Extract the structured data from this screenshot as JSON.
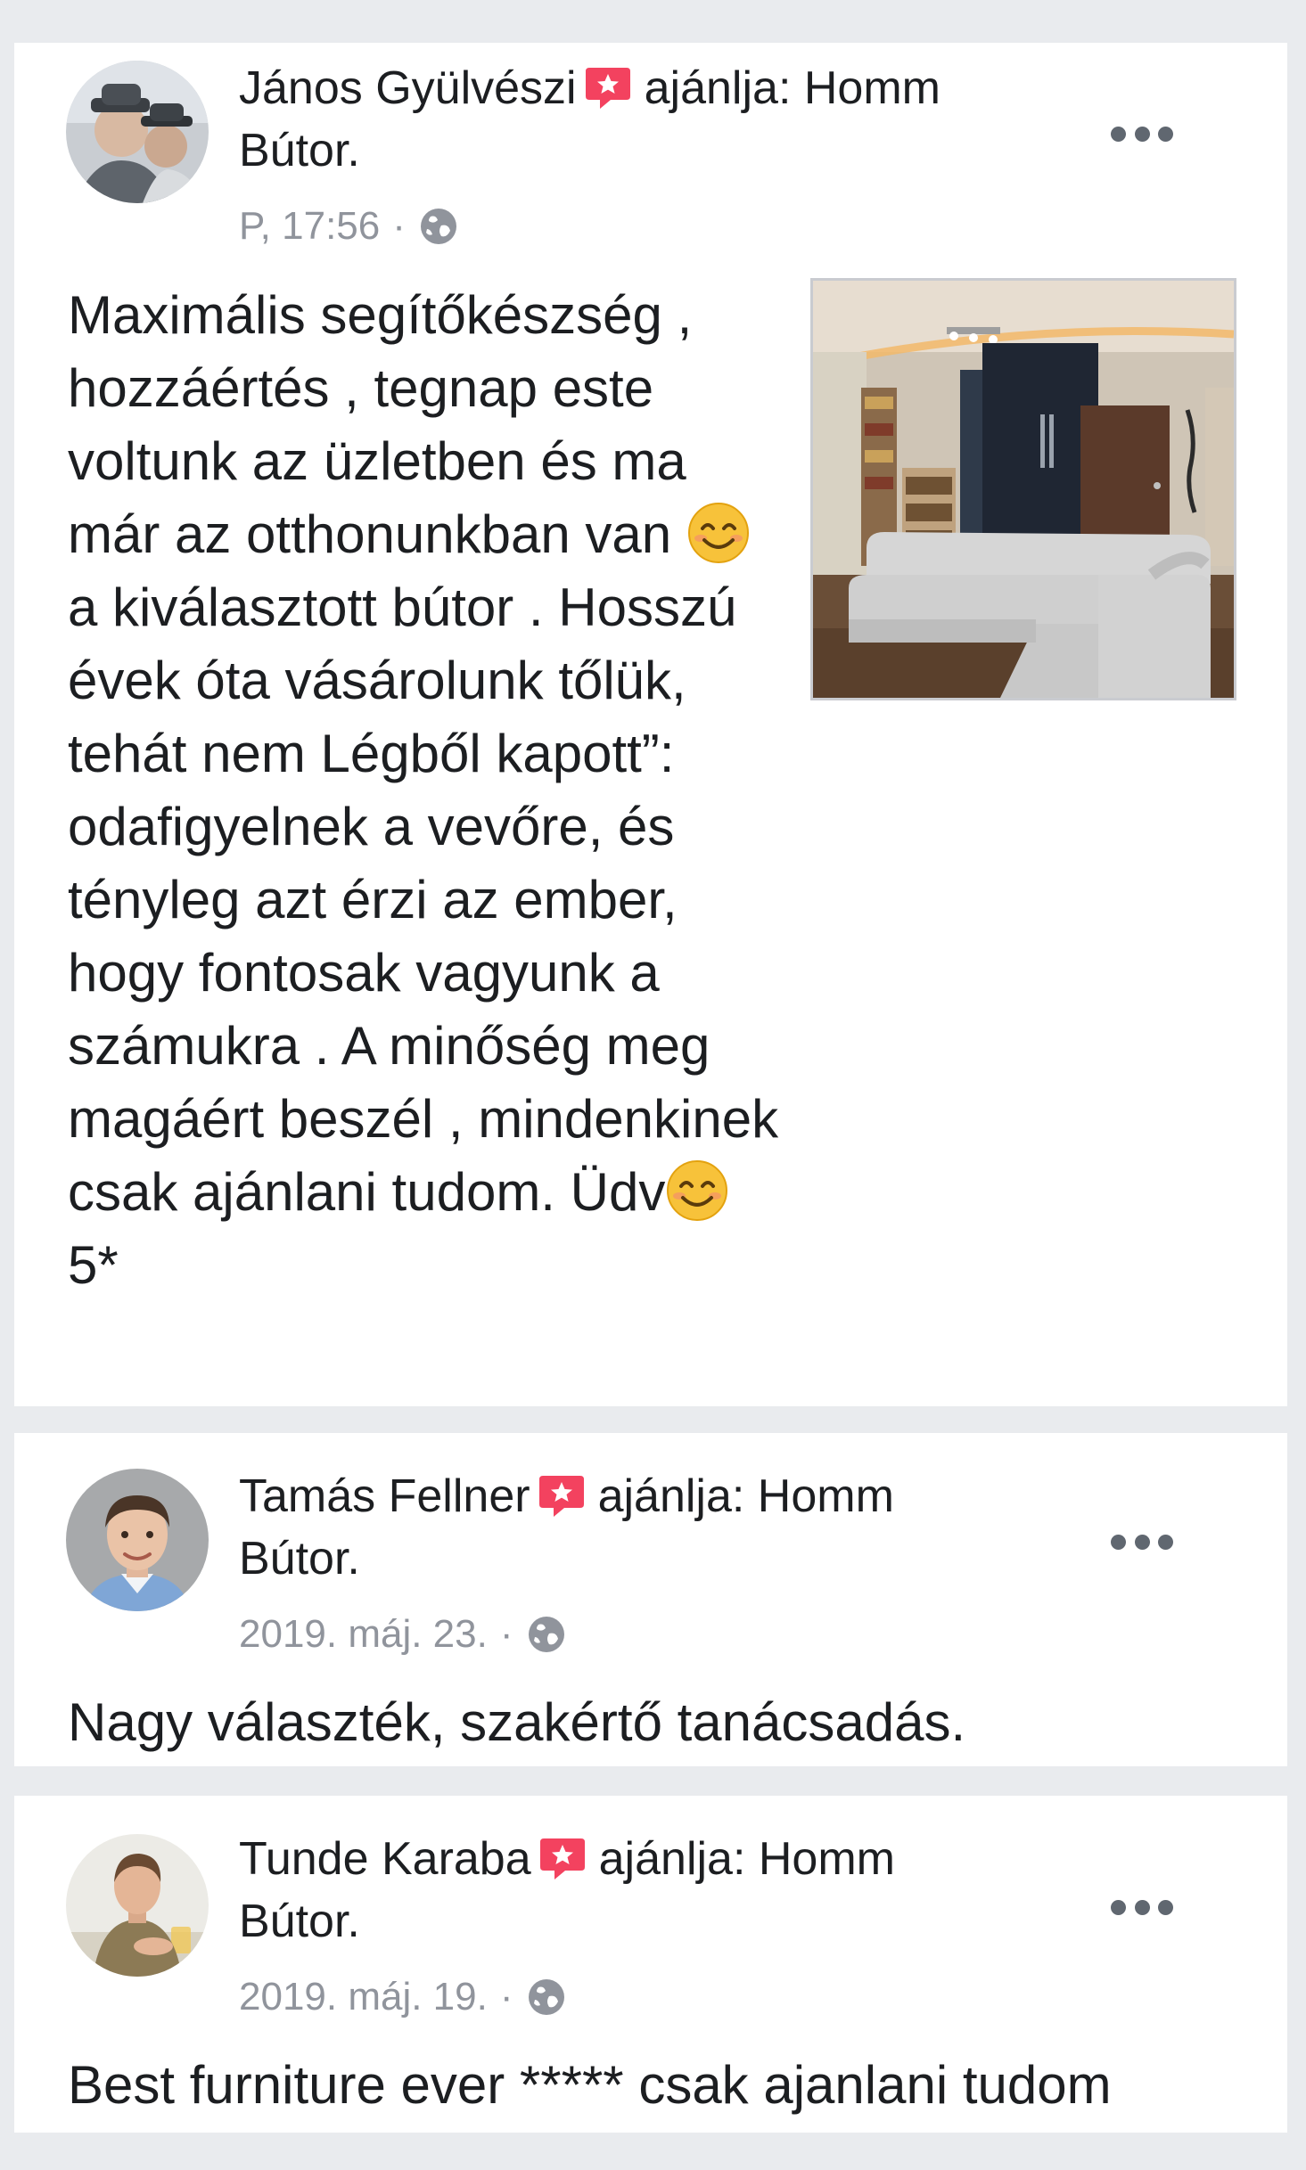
{
  "reviews": [
    {
      "author": "János Gyülvészi",
      "recommends": "ajánlja: Homm",
      "page_name": "Bútor.",
      "time": "P, 17:56",
      "text_before_emoji": "Maximális segítőkészség , hozzáértés , tegnap este voltunk az üzletben és ma már az otthonunkban van ",
      "text_after_emoji": " a kiválasztott bútor . Hosszú évek óta vásárolunk tőlük, tehát nem Légből kapott”: odafigyelnek a vevőre, és tényleg azt érzi az ember, hogy fontosak vagyunk a számukra . A minőség meg magáért beszél , mindenkinek csak ajánlani tudom. Üdv",
      "text_end": " 5*",
      "emoji_icon": "smiling-face-emoji",
      "photo_icon": "living-room-sofa-photo"
    },
    {
      "author": "Tamás Fellner",
      "recommends": "ajánlja: Homm",
      "page_name": "Bútor.",
      "time": "2019. máj. 23.",
      "text": "Nagy választék, szakértő tanácsadás."
    },
    {
      "author": "Tunde Karaba",
      "recommends": "ajánlja: Homm",
      "page_name": "Bútor.",
      "time": "2019. máj. 19.",
      "text": "Best furniture ever ***** csak ajanlani tudom"
    }
  ],
  "separator": "·",
  "icons": {
    "recommend_badge": "recommend-badge-icon",
    "audience": "globe-icon",
    "more": "more-options-icon"
  },
  "colors": {
    "background": "#e9ebee",
    "card": "#ffffff",
    "text": "#1c1e21",
    "meta": "#90949c",
    "badge": "#f3425f"
  }
}
